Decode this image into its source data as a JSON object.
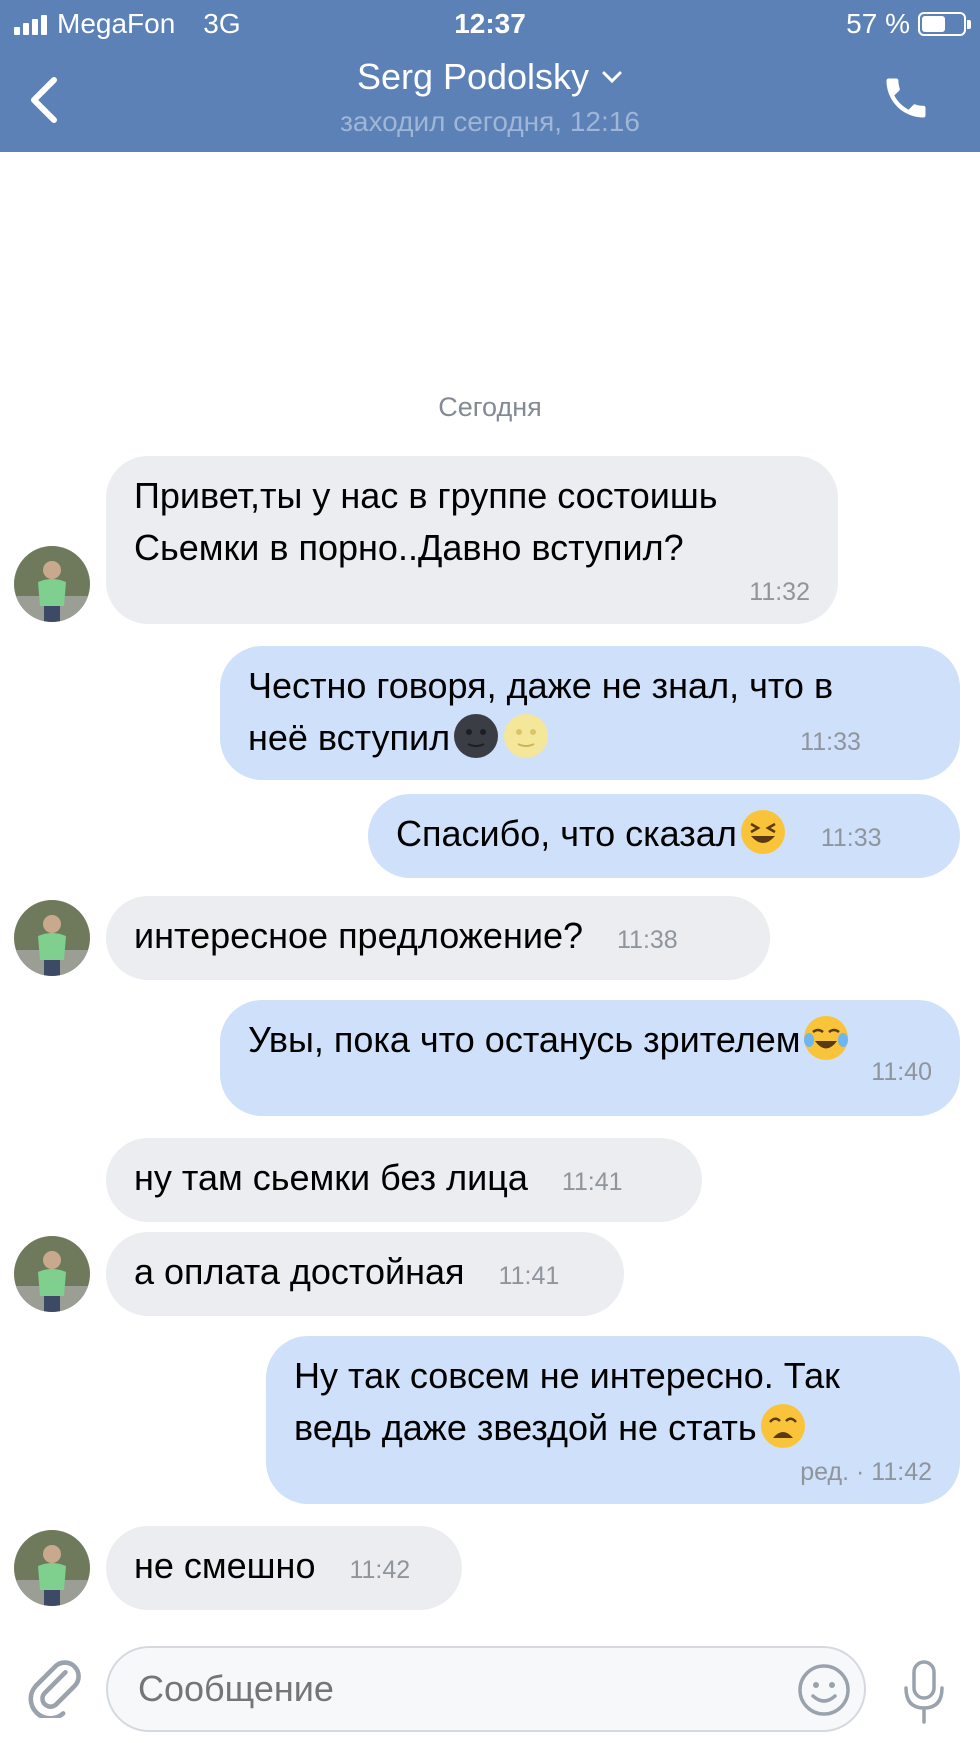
{
  "status_bar": {
    "carrier": "MegaFon",
    "network": "3G",
    "time": "12:37",
    "battery": "57 %",
    "battery_level": 0.57
  },
  "header": {
    "title": "Serg Podolsky",
    "subtitle": "заходил сегодня, 12:16",
    "back_icon": "chevron-left-icon",
    "call_icon": "phone-icon"
  },
  "day_separator": "Сегодня",
  "messages": [
    {
      "dir": "in",
      "lines": [
        "Привет,ты у нас в группе состоишь",
        "Сьемки в порно..Давно вступил?"
      ],
      "time": "11:32"
    },
    {
      "dir": "out",
      "lines": [
        "Честно говоря, даже не знал, что в",
        "неё вступил"
      ],
      "emoji": [
        "new-moon-face",
        "full-moon-face"
      ],
      "time": "11:33"
    },
    {
      "dir": "out",
      "text": "Спасибо, что сказал",
      "emoji": [
        "grinning-squinting-face"
      ],
      "time": "11:33"
    },
    {
      "dir": "in",
      "text": "интересное предложение?",
      "time": "11:38"
    },
    {
      "dir": "out",
      "text": "Увы, пока что останусь зрителем",
      "emoji": [
        "tears-of-joy-face"
      ],
      "time": "11:40"
    },
    {
      "dir": "in",
      "text": "ну там сьемки без лица",
      "time": "11:41"
    },
    {
      "dir": "in",
      "text": "а оплата достойная",
      "time": "11:41"
    },
    {
      "dir": "out",
      "lines": [
        "Ну так совсем не интересно. Так",
        "ведь даже звездой не стать"
      ],
      "emoji": [
        "weary-face"
      ],
      "time": "ред. · 11:42"
    },
    {
      "dir": "in",
      "text": "не смешно",
      "time": "11:42"
    }
  ],
  "input": {
    "placeholder": "Сообщение",
    "attach_icon": "paperclip-icon",
    "smile_icon": "smile-icon",
    "mic_icon": "microphone-icon"
  },
  "colors": {
    "header": "#5b81b7",
    "incoming_bubble": "#ebedf0",
    "outgoing_bubble": "#cfe0fa"
  }
}
